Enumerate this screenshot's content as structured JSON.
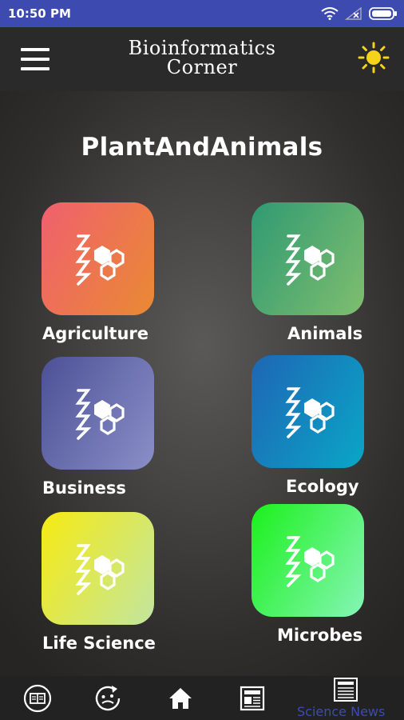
{
  "status_bar": {
    "time": "10:50 PM"
  },
  "app_bar": {
    "brand_line1": "Bioinformatics",
    "brand_line2": "Corner"
  },
  "page": {
    "title": "PlantAndAnimals"
  },
  "categories": [
    {
      "label": "Agriculture",
      "gradient": [
        "#f0606e",
        "#e98a33"
      ]
    },
    {
      "label": "Animals",
      "gradient": [
        "#2f9a72",
        "#7fbe6f"
      ]
    },
    {
      "label": "Business",
      "gradient": [
        "#4c5196",
        "#8a8fc8"
      ]
    },
    {
      "label": "Ecology",
      "gradient": [
        "#1e66b4",
        "#0aa6c7"
      ]
    },
    {
      "label": "Life Science",
      "gradient": [
        "#f6ea12",
        "#c2e6a0"
      ]
    },
    {
      "label": "Microbes",
      "gradient": [
        "#1bf11c",
        "#86f5b6"
      ]
    }
  ],
  "bottom_nav": {
    "items": [
      {
        "icon": "book-icon"
      },
      {
        "icon": "quiz-icon"
      },
      {
        "icon": "home-icon"
      },
      {
        "icon": "paper-icon"
      },
      {
        "icon": "science-news-icon",
        "label": "Science News"
      }
    ],
    "active_color": "#3d4bb0"
  },
  "colors": {
    "status_bar": "#3d4bb0",
    "app_bar": "#2a2a2a",
    "sun": "#f6d21a"
  }
}
